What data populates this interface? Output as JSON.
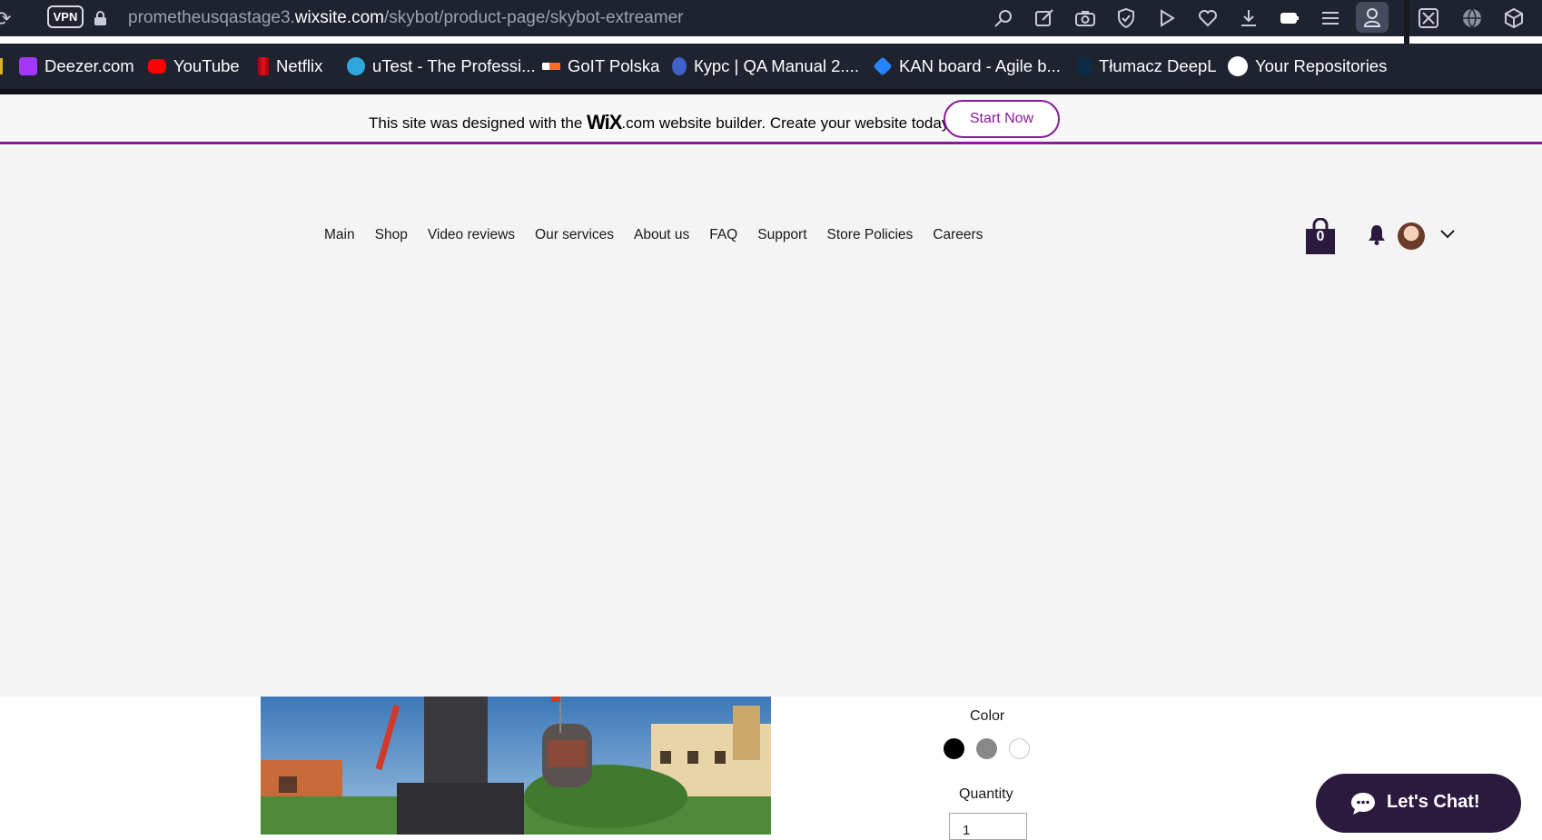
{
  "browser": {
    "vpn_label": "VPN",
    "url_host": "prometheusqastage3.",
    "url_domain": "wixsite.com",
    "url_path": "/skybot/product-page/skybot-extreamer"
  },
  "bookmarks": [
    {
      "label": "Deezer.com"
    },
    {
      "label": "YouTube"
    },
    {
      "label": "Netflix"
    },
    {
      "label": "uTest - The Professi..."
    },
    {
      "label": "GoIT Polska"
    },
    {
      "label": "Курс | QA Manual 2...."
    },
    {
      "label": "KAN board - Agile b..."
    },
    {
      "label": "Tłumacz DeepL"
    },
    {
      "label": "Your Repositories"
    }
  ],
  "wix_banner": {
    "text_before": "This site was designed with the ",
    "logo": "WiX",
    "text_after": ".com website builder. Create your website today.",
    "cta": "Start Now"
  },
  "nav": {
    "items": [
      "Main",
      "Shop",
      "Video reviews",
      "Our services",
      "About us",
      "FAQ",
      "Support",
      "Store Policies",
      "Careers"
    ]
  },
  "header": {
    "cart_count": "0"
  },
  "product": {
    "color_label": "Color",
    "colors": [
      "#000000",
      "#888888",
      "#ffffff"
    ],
    "quantity_label": "Quantity",
    "quantity_value": "1"
  },
  "chat": {
    "label": "Let's Chat!"
  }
}
